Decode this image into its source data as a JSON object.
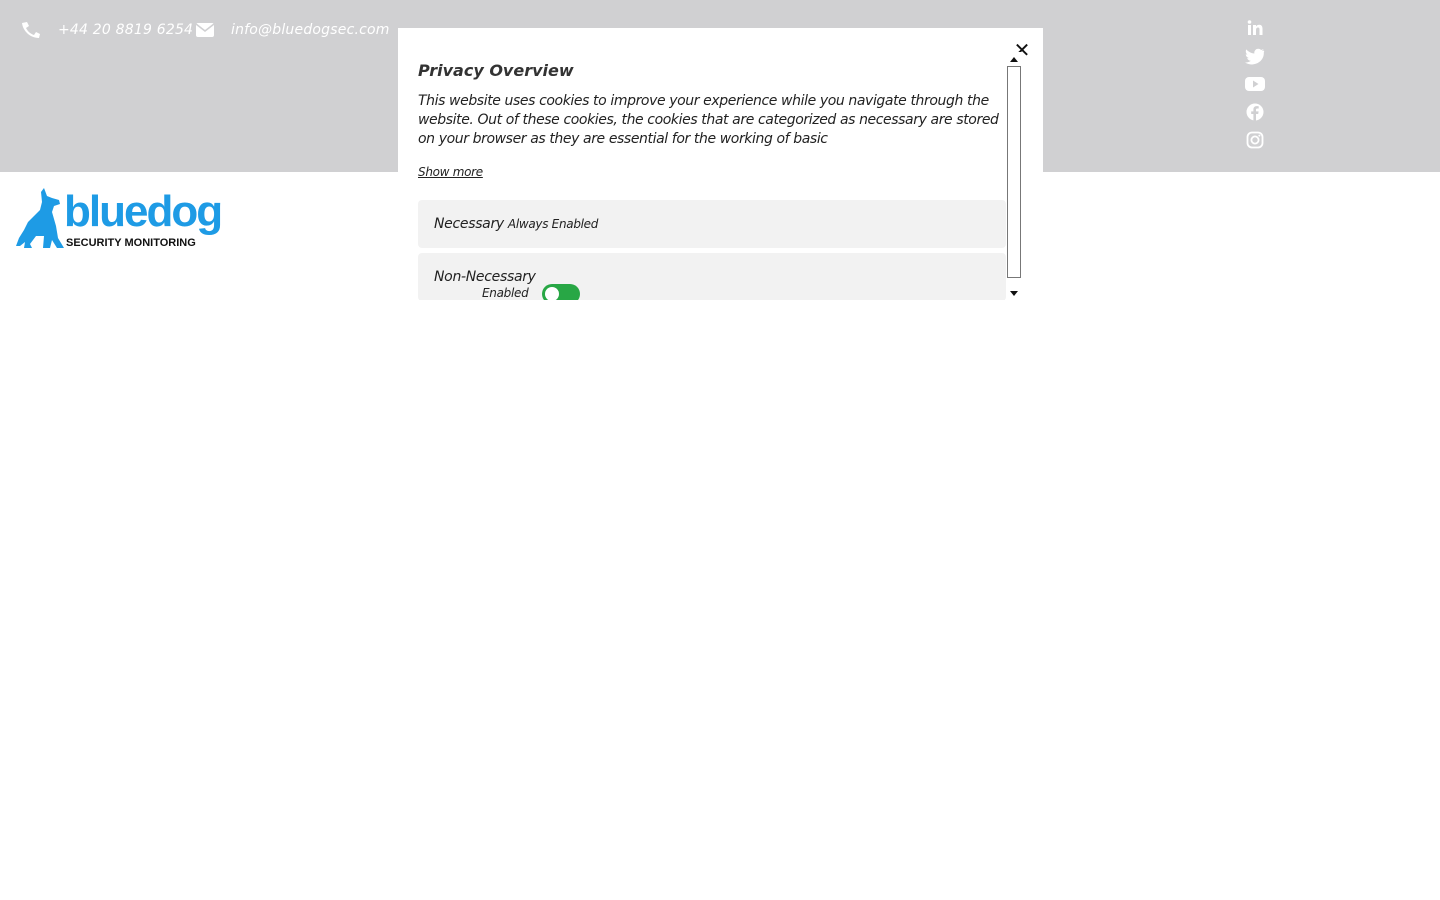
{
  "contact": {
    "phone": "+44 20 8819 6254",
    "email": "info@bluedogsec.com",
    "phone_icon": "phone-icon",
    "email_icon": "envelope-icon"
  },
  "social": [
    {
      "name": "linkedin-icon"
    },
    {
      "name": "twitter-icon"
    },
    {
      "name": "youtube-icon"
    },
    {
      "name": "facebook-icon"
    },
    {
      "name": "instagram-icon"
    }
  ],
  "logo": {
    "word": "bluedog",
    "tagline": "SECURITY MONITORING",
    "color": "#1e9be5"
  },
  "modal": {
    "title": "Privacy Overview",
    "description": "This website uses cookies to improve your experience while you navigate through the website. Out of these cookies, the cookies that are categorized as necessary are stored on your browser as they are essential for the working of basic",
    "show_more": "Show more",
    "close": "✕",
    "sections": [
      {
        "title": "Necessary",
        "status": "Always Enabled"
      },
      {
        "title": "Non-Necessary",
        "status": "Enabled",
        "toggle_on": true
      }
    ]
  },
  "colors": {
    "topbar": "#d0d0d2",
    "toggle": "#28a745"
  }
}
